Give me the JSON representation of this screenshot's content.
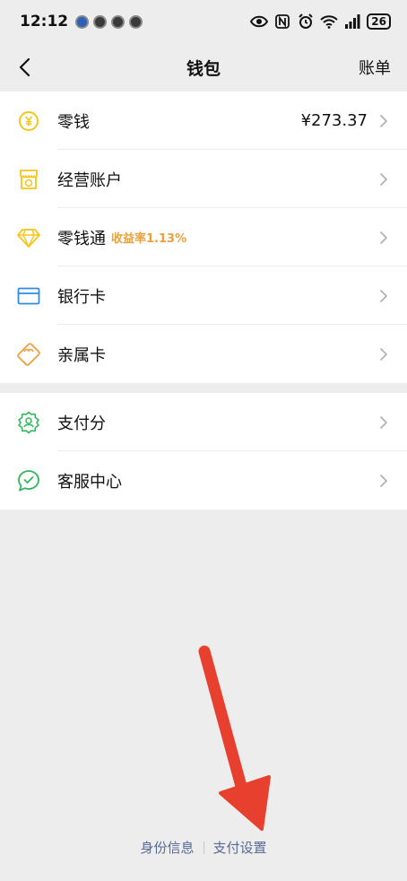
{
  "status": {
    "time": "12:12",
    "battery": "26"
  },
  "nav": {
    "title": "钱包",
    "right_label": "账单"
  },
  "group1": [
    {
      "label": "零钱",
      "value": "¥273.37",
      "icon": "yuan-coin-icon"
    },
    {
      "label": "经营账户",
      "icon": "merchant-account-icon"
    },
    {
      "label": "零钱通",
      "sub": "收益率1.13%",
      "icon": "diamond-icon"
    },
    {
      "label": "银行卡",
      "icon": "bank-card-icon"
    },
    {
      "label": "亲属卡",
      "icon": "family-card-icon"
    }
  ],
  "group2": [
    {
      "label": "支付分",
      "icon": "pay-score-icon"
    },
    {
      "label": "客服中心",
      "icon": "customer-service-icon"
    }
  ],
  "footer": {
    "identity": "身份信息",
    "pay_settings": "支付设置"
  },
  "colors": {
    "background": "#ededed",
    "link": "#576b95",
    "yellow_icon": "#f5c518",
    "blue_icon": "#2b8ce8",
    "orange_icon": "#f0a13c",
    "green_icon": "#2fb85a",
    "yield_text": "#e9a13b",
    "annotation_arrow": "#e8402e"
  }
}
